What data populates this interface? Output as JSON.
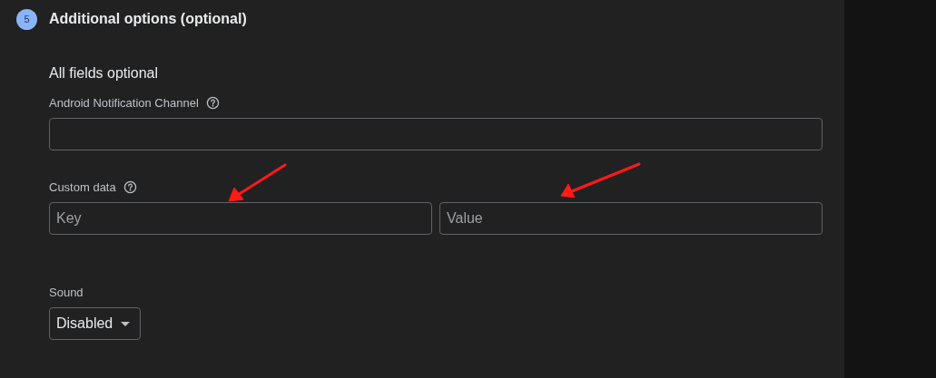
{
  "step": {
    "number": "5",
    "title": "Additional options (optional)"
  },
  "subtitle": "All fields optional",
  "fields": [
    {
      "kind": "text",
      "label": "Android Notification Channel",
      "help": true
    },
    {
      "kind": "pair",
      "label": "Custom data",
      "help": true,
      "placeholders": [
        "Key",
        "Value"
      ]
    },
    {
      "kind": "select",
      "label": "Sound",
      "help": false,
      "value": "Disabled"
    }
  ]
}
